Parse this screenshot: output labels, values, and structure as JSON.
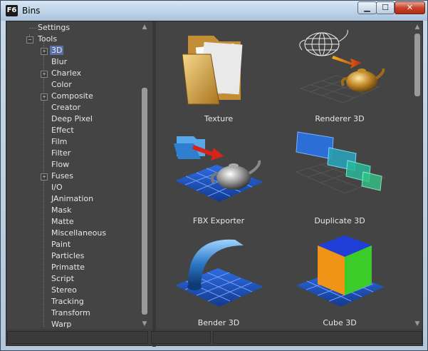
{
  "window": {
    "app_icon_text": "F6",
    "title": "Bins",
    "minimize_symbol": "▁",
    "maximize_symbol": "☐",
    "close_symbol": "✕"
  },
  "tree": {
    "expand_symbol": "+",
    "collapse_symbol": "−",
    "items": [
      {
        "label": "Settings"
      },
      {
        "label": "Tools"
      },
      {
        "label": "3D"
      },
      {
        "label": "Blur"
      },
      {
        "label": "Charlex"
      },
      {
        "label": "Color"
      },
      {
        "label": "Composite"
      },
      {
        "label": "Creator"
      },
      {
        "label": "Deep Pixel"
      },
      {
        "label": "Effect"
      },
      {
        "label": "Film"
      },
      {
        "label": "Filter"
      },
      {
        "label": "Flow"
      },
      {
        "label": "Fuses"
      },
      {
        "label": "I/O"
      },
      {
        "label": "JAnimation"
      },
      {
        "label": "Mask"
      },
      {
        "label": "Matte"
      },
      {
        "label": "Miscellaneous"
      },
      {
        "label": "Paint"
      },
      {
        "label": "Particles"
      },
      {
        "label": "Primatte"
      },
      {
        "label": "Script"
      },
      {
        "label": "Stereo"
      },
      {
        "label": "Tracking"
      },
      {
        "label": "Transform"
      },
      {
        "label": "Warp"
      }
    ]
  },
  "bins": [
    {
      "label": "Texture",
      "icon": "texture-folder-icon"
    },
    {
      "label": "Renderer 3D",
      "icon": "renderer-teapot-icon"
    },
    {
      "label": "FBX Exporter",
      "icon": "fbx-exporter-icon"
    },
    {
      "label": "Duplicate 3D",
      "icon": "duplicate-panels-icon"
    },
    {
      "label": "Bender 3D",
      "icon": "bender-tube-icon"
    },
    {
      "label": "Cube 3D",
      "icon": "cube-icon"
    }
  ],
  "scroll": {
    "up": "▲",
    "down": "▼"
  },
  "colors": {
    "panel_bg": "#444444",
    "selection": "#5a6fa6",
    "grid_blue": "#1f4fc4",
    "close_red": "#c8442c"
  }
}
